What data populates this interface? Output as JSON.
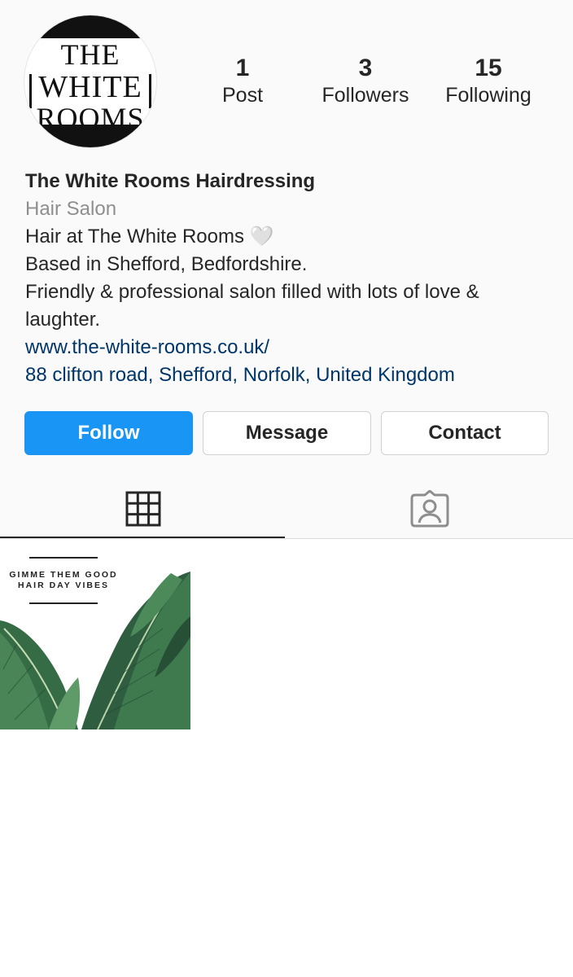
{
  "profile": {
    "avatar_lines": [
      "THE",
      "WHITE",
      "ROOMS"
    ],
    "stats": [
      {
        "value": "1",
        "label": "Post"
      },
      {
        "value": "3",
        "label": "Followers"
      },
      {
        "value": "15",
        "label": "Following"
      }
    ],
    "name": "The White Rooms Hairdressing",
    "category": "Hair Salon",
    "bio_lines": [
      "Hair at The White Rooms",
      "Based in Shefford, Bedfordshire.",
      "Friendly & professional salon filled with lots of love & laughter."
    ],
    "heart": "🤍",
    "website": "www.the-white-rooms.co.uk/",
    "address": "88 clifton road, Shefford, Norfolk, United Kingdom"
  },
  "actions": {
    "follow": "Follow",
    "message": "Message",
    "contact": "Contact"
  },
  "tabs": [
    {
      "icon": "grid-icon",
      "active": true
    },
    {
      "icon": "tagged-person-icon",
      "active": false
    }
  ],
  "posts": [
    {
      "caption_lines": [
        "GIMME THEM GOOD",
        "HAIR DAY VIBES"
      ]
    }
  ],
  "colors": {
    "accent": "#1995f6",
    "link": "#003569",
    "muted": "#8e8e8e",
    "text": "#262626",
    "header_bg": "#fafafa"
  }
}
